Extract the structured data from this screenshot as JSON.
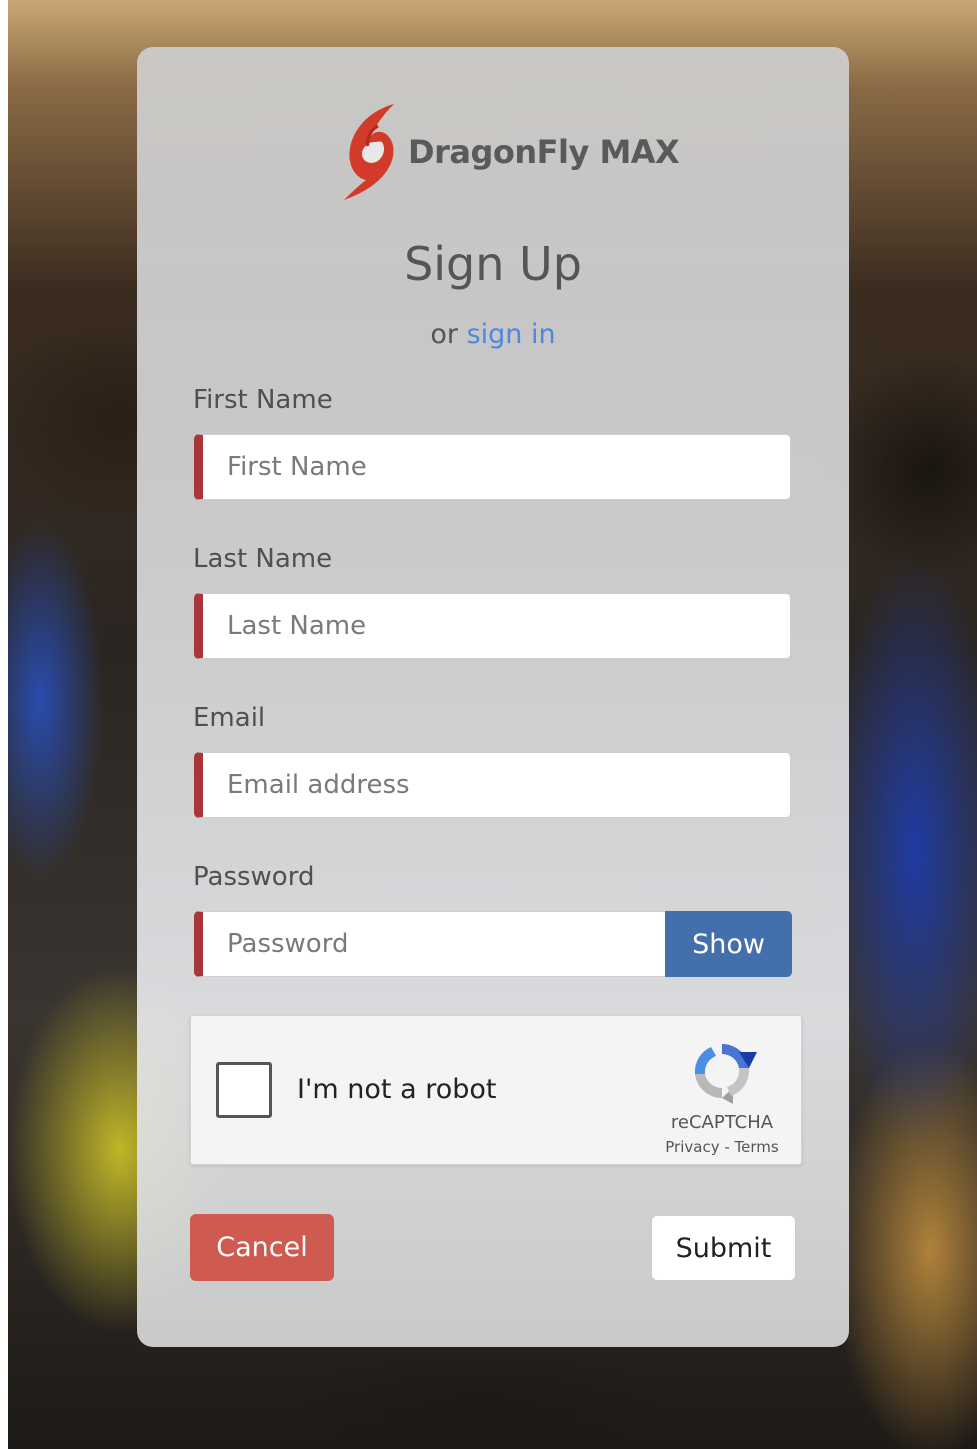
{
  "brand": {
    "name": "DragonFly MAX",
    "logo_color": "#d23a2a"
  },
  "heading": {
    "title": "Sign Up",
    "or_text": "or ",
    "sign_in_link": "sign in",
    "link_color": "#4f86e0"
  },
  "form": {
    "first_name": {
      "label": "First Name",
      "placeholder": "First Name",
      "value": ""
    },
    "last_name": {
      "label": "Last Name",
      "placeholder": "Last Name",
      "value": ""
    },
    "email": {
      "label": "Email",
      "placeholder": "Email address",
      "value": ""
    },
    "password": {
      "label": "Password",
      "placeholder": "Password",
      "value": "",
      "show_label": "Show"
    },
    "required_accent": "#a9373a"
  },
  "captcha": {
    "label": "I'm not a robot",
    "checked": false,
    "brand": "reCAPTCHA",
    "privacy": "Privacy",
    "separator": " - ",
    "terms": "Terms"
  },
  "actions": {
    "cancel_label": "Cancel",
    "submit_label": "Submit",
    "cancel_color": "#cf5a50",
    "show_color": "#4370ad"
  }
}
